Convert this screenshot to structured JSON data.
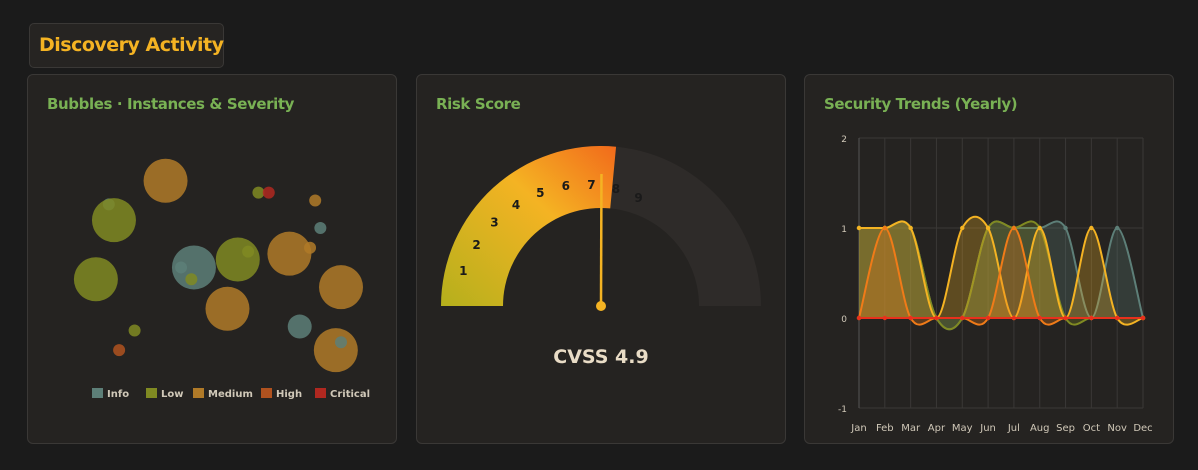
{
  "section": {
    "title": "Discovery Activity"
  },
  "colors": {
    "info": "#5d7f78",
    "low": "#808a22",
    "medium": "#b07a28",
    "high": "#b0521f",
    "critical": "#b02820"
  },
  "bubbles": {
    "title": "Bubbles · Instances & Severity",
    "legend": [
      {
        "label": "Info",
        "color": "#5d7f78"
      },
      {
        "label": "Low",
        "color": "#808a22"
      },
      {
        "label": "Medium",
        "color": "#b07a28"
      },
      {
        "label": "High",
        "color": "#b0521f"
      },
      {
        "label": "Critical",
        "color": "#b02820"
      }
    ]
  },
  "gauge": {
    "title": "Risk Score",
    "label": "CVSS 4.9"
  },
  "trends": {
    "title": "Security Trends (Yearly)"
  },
  "chart_data": [
    {
      "type": "scatter",
      "title": "Bubbles · Instances & Severity",
      "legend": [
        "Info",
        "Low",
        "Medium",
        "High",
        "Critical"
      ],
      "points": [
        {
          "x": 0.32,
          "y": 0.92,
          "r": 3,
          "series": "Medium"
        },
        {
          "x": 0.1,
          "y": 0.8,
          "r": 1,
          "series": "Info"
        },
        {
          "x": 0.12,
          "y": 0.72,
          "r": 3,
          "series": "Low"
        },
        {
          "x": 0.68,
          "y": 0.86,
          "r": 1,
          "series": "Low"
        },
        {
          "x": 0.72,
          "y": 0.86,
          "r": 1,
          "series": "Critical"
        },
        {
          "x": 0.9,
          "y": 0.82,
          "r": 1,
          "series": "Medium"
        },
        {
          "x": 0.92,
          "y": 0.68,
          "r": 1,
          "series": "Info"
        },
        {
          "x": 0.88,
          "y": 0.58,
          "r": 1,
          "series": "Medium"
        },
        {
          "x": 0.8,
          "y": 0.55,
          "r": 3,
          "series": "Medium"
        },
        {
          "x": 0.6,
          "y": 0.52,
          "r": 3,
          "series": "Low"
        },
        {
          "x": 0.64,
          "y": 0.56,
          "r": 1,
          "series": "Low"
        },
        {
          "x": 0.43,
          "y": 0.48,
          "r": 3,
          "series": "Info"
        },
        {
          "x": 0.38,
          "y": 0.48,
          "r": 1,
          "series": "Info"
        },
        {
          "x": 0.42,
          "y": 0.42,
          "r": 1,
          "series": "Low"
        },
        {
          "x": 0.05,
          "y": 0.42,
          "r": 3,
          "series": "Low"
        },
        {
          "x": 0.56,
          "y": 0.27,
          "r": 3,
          "series": "Medium"
        },
        {
          "x": 1.0,
          "y": 0.38,
          "r": 3,
          "series": "Medium"
        },
        {
          "x": 0.84,
          "y": 0.18,
          "r": 2,
          "series": "Info"
        },
        {
          "x": 0.2,
          "y": 0.16,
          "r": 1,
          "series": "Low"
        },
        {
          "x": 0.14,
          "y": 0.06,
          "r": 1,
          "series": "High"
        },
        {
          "x": 0.98,
          "y": 0.06,
          "r": 3,
          "series": "Medium"
        },
        {
          "x": 1.0,
          "y": 0.1,
          "r": 1,
          "series": "Info"
        }
      ]
    },
    {
      "type": "gauge",
      "title": "Risk Score",
      "value": 4.9,
      "min": 0,
      "max": 10,
      "tick_labels": [
        "1",
        "2",
        "3",
        "4",
        "5",
        "6",
        "7",
        "8",
        "9"
      ]
    },
    {
      "type": "line",
      "title": "Security Trends (Yearly)",
      "categories": [
        "Jan",
        "Feb",
        "Mar",
        "Apr",
        "May",
        "Jun",
        "Jul",
        "Aug",
        "Sep",
        "Oct",
        "Nov",
        "Dec"
      ],
      "ylim": [
        -1,
        2
      ],
      "yticks": [
        "2",
        "1",
        "0",
        "-1"
      ],
      "grid": true,
      "series": [
        {
          "color": "#5d7f78",
          "values": [
            1,
            1,
            1,
            0,
            0,
            1,
            1,
            1,
            1,
            0,
            1,
            0
          ]
        },
        {
          "color": "#808a22",
          "values": [
            1,
            1,
            1,
            0,
            0,
            1,
            1,
            1,
            0,
            0,
            0,
            0
          ]
        },
        {
          "color": "#f4b323",
          "values": [
            1,
            1,
            1,
            0,
            1,
            1,
            0,
            1,
            0,
            1,
            0,
            0
          ]
        },
        {
          "color": "#f07b18",
          "values": [
            0,
            1,
            0,
            0,
            0,
            0,
            1,
            0,
            0,
            0,
            0,
            0
          ]
        },
        {
          "color": "#e8301c",
          "values": [
            0,
            0,
            0,
            0,
            0,
            0,
            0,
            0,
            0,
            0,
            0,
            0
          ]
        }
      ]
    }
  ]
}
